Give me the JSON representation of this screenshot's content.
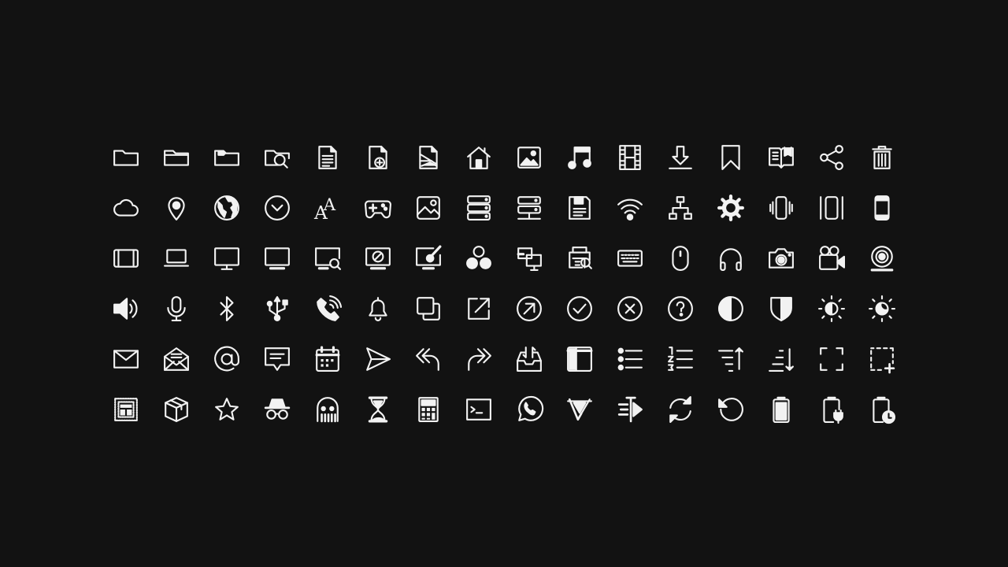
{
  "stroke_color": "#f2f2f2",
  "background_color": "#121212",
  "icon_rows": [
    [
      "folder-icon",
      "folder-open-icon",
      "folder-tag-icon",
      "folder-search-icon",
      "document-icon",
      "document-add-icon",
      "document-image-icon",
      "home-icon",
      "image-icon",
      "music-icon",
      "film-icon",
      "download-icon",
      "bookmark-icon",
      "book-open-icon",
      "share-icon",
      "trash-icon"
    ],
    [
      "cloud-icon",
      "map-pin-icon",
      "globe-icon",
      "clock-icon",
      "font-icon",
      "gamepad-icon",
      "image-frame-icon",
      "server-icon",
      "server-stack-icon",
      "save-floppy-icon",
      "wifi-icon",
      "network-icon",
      "gear-icon",
      "phone-vibrate-icon",
      "phone-shake-icon",
      "smartphone-icon"
    ],
    [
      "tablet-landscape-icon",
      "laptop-icon",
      "monitor-icon",
      "display-icon",
      "monitor-search-icon",
      "monitor-block-icon",
      "monitor-pen-icon",
      "circles-icon",
      "devices-icon",
      "printer-search-icon",
      "keyboard-icon",
      "mouse-icon",
      "headphones-icon",
      "camera-icon",
      "video-camera-icon",
      "webcam-icon"
    ],
    [
      "volume-icon",
      "microphone-icon",
      "bluetooth-icon",
      "usb-icon",
      "phone-ring-icon",
      "bell-icon",
      "copy-icon",
      "external-link-icon",
      "arrow-up-right-circle-icon",
      "check-circle-icon",
      "close-circle-icon",
      "help-circle-icon",
      "contrast-icon",
      "shield-icon",
      "brightness-icon",
      "night-mode-icon"
    ],
    [
      "mail-icon",
      "mail-open-icon",
      "at-icon",
      "chat-icon",
      "calendar-icon",
      "send-icon",
      "reply-all-icon",
      "forward-all-icon",
      "inbox-icon",
      "sidebar-icon",
      "list-bullet-icon",
      "list-numbered-icon",
      "sort-ascending-icon",
      "sort-descending-icon",
      "fullscreen-icon",
      "select-add-icon"
    ],
    [
      "layout-grid-icon",
      "package-icon",
      "star-icon",
      "incognito-icon",
      "ghost-icon",
      "hourglass-icon",
      "calculator-icon",
      "terminal-icon",
      "whatsapp-icon",
      "vivaldi-icon",
      "fast-forward-icon",
      "sync-icon",
      "undo-icon",
      "battery-icon",
      "battery-charging-icon",
      "battery-clock-icon"
    ]
  ]
}
